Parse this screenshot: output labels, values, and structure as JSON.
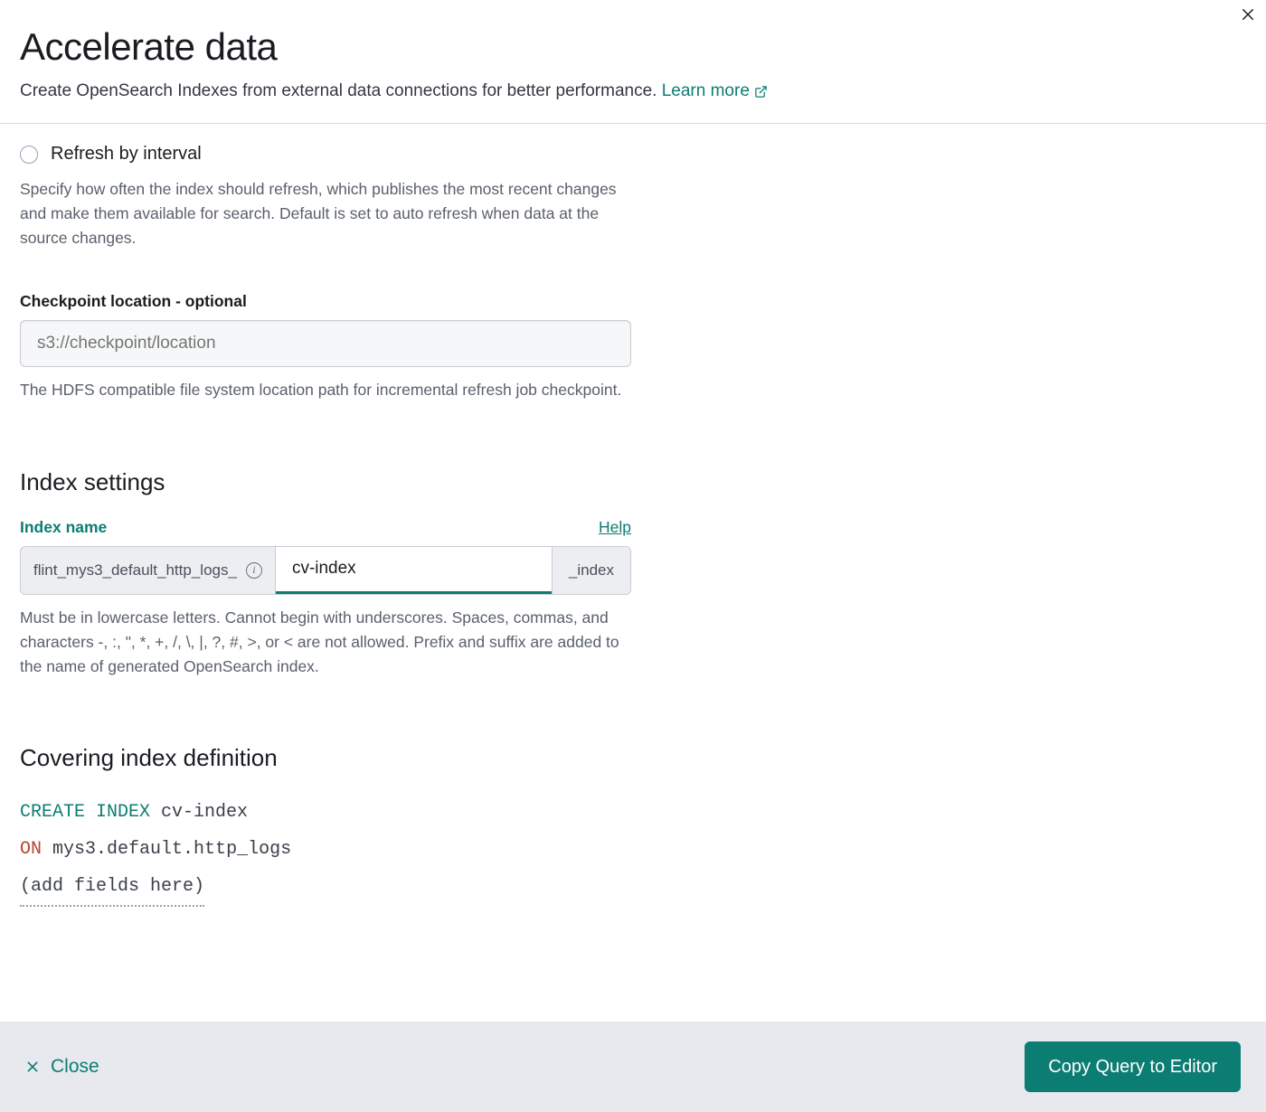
{
  "header": {
    "title": "Accelerate data",
    "subtitle_prefix": "Create OpenSearch Indexes from external data connections for better performance. ",
    "learn_more_label": "Learn more"
  },
  "refresh_section": {
    "radio_label": "Refresh by interval",
    "description": "Specify how often the index should refresh, which publishes the most recent changes and make them available for search. Default is set to auto refresh when data at the source changes."
  },
  "checkpoint": {
    "label": "Checkpoint location - optional",
    "placeholder": "s3://checkpoint/location",
    "value": "",
    "help": "The HDFS compatible file system location path for incremental refresh job checkpoint."
  },
  "index_settings": {
    "title": "Index settings",
    "name_label": "Index name",
    "help_link": "Help",
    "prefix": "flint_mys3_default_http_logs_",
    "value": "cv-index",
    "suffix": "_index",
    "validation_help": "Must be in lowercase letters. Cannot begin with underscores. Spaces, commas, and characters -, :, \", *, +, /, \\, |, ?, #, >, or < are not allowed. Prefix and suffix are added to the name of generated OpenSearch index."
  },
  "covering_index": {
    "title": "Covering index definition",
    "kw_create": "CREATE INDEX",
    "name": "cv-index",
    "kw_on": "ON",
    "table": "mys3.default.http_logs",
    "fields_placeholder": "(add fields here)"
  },
  "footer": {
    "close_label": "Close",
    "primary_label": "Copy Query to Editor"
  }
}
